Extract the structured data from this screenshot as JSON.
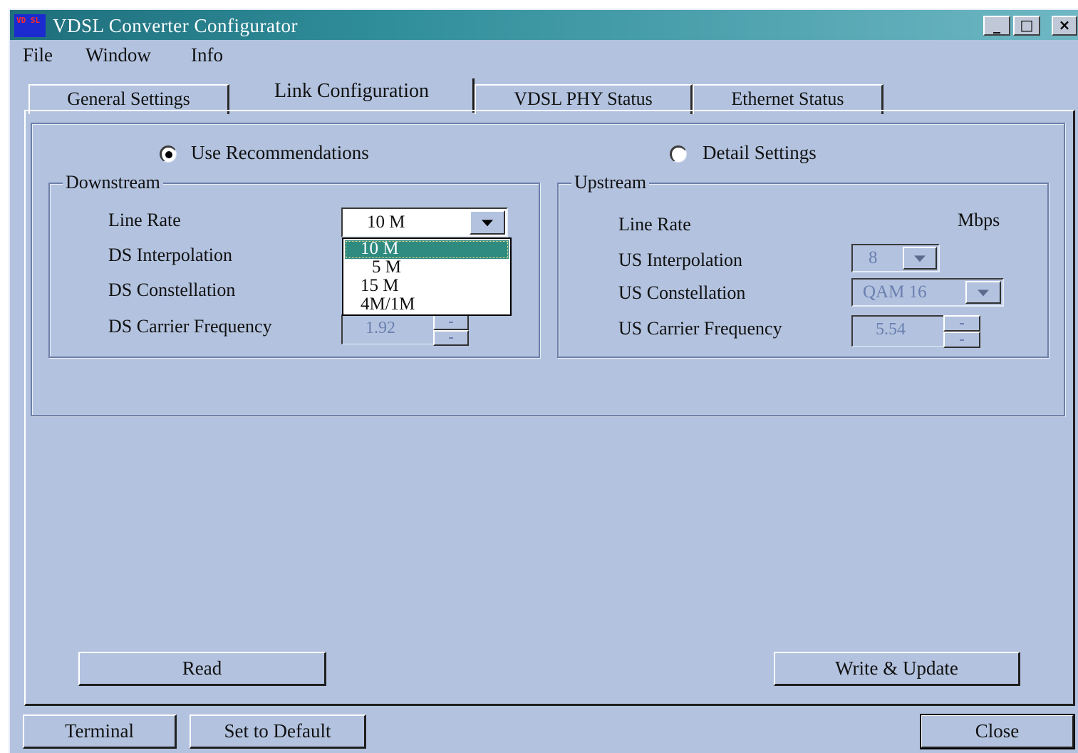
{
  "window": {
    "icon_text": "VD SL",
    "title": "VDSL Converter Configurator",
    "minimize_label": "_",
    "maximize_label": "□",
    "close_label": "×"
  },
  "menu": [
    "File",
    "Window",
    "Info"
  ],
  "tabs": [
    {
      "label": "General Settings",
      "active": false
    },
    {
      "label": "Link Configuration",
      "active": true
    },
    {
      "label": "VDSL PHY Status",
      "active": false
    },
    {
      "label": "Ethernet Status",
      "active": false
    }
  ],
  "mode": {
    "use_recommendations": {
      "label": "Use Recommendations",
      "checked": true
    },
    "detail_settings": {
      "label": "Detail Settings",
      "checked": false
    }
  },
  "downstream": {
    "title": "Downstream",
    "line_rate_label": "Line Rate",
    "line_rate_value": "10 M",
    "line_rate_options": [
      "10 M",
      "5 M",
      "15 M",
      "4M/1M"
    ],
    "line_rate_selected_index": 0,
    "interpolation_label": "DS Interpolation",
    "constellation_label": "DS Constellation",
    "carrier_label": "DS Carrier Frequency",
    "carrier_value": "1.92"
  },
  "upstream": {
    "title": "Upstream",
    "line_rate_label": "Line Rate",
    "line_rate_unit": "Mbps",
    "interpolation_label": "US Interpolation",
    "interpolation_value": "8",
    "constellation_label": "US Constellation",
    "constellation_value": "QAM 16",
    "carrier_label": "US Carrier Frequency",
    "carrier_value": "5.54"
  },
  "buttons": {
    "read": "Read",
    "write_update": "Write & Update",
    "terminal": "Terminal",
    "set_default": "Set to Default",
    "close": "Close"
  },
  "colors": {
    "window_bg": "#b3c3df",
    "titlebar": "#2f8e9a",
    "selection": "#2f8a80",
    "disabled_text": "#6a7fb0"
  }
}
